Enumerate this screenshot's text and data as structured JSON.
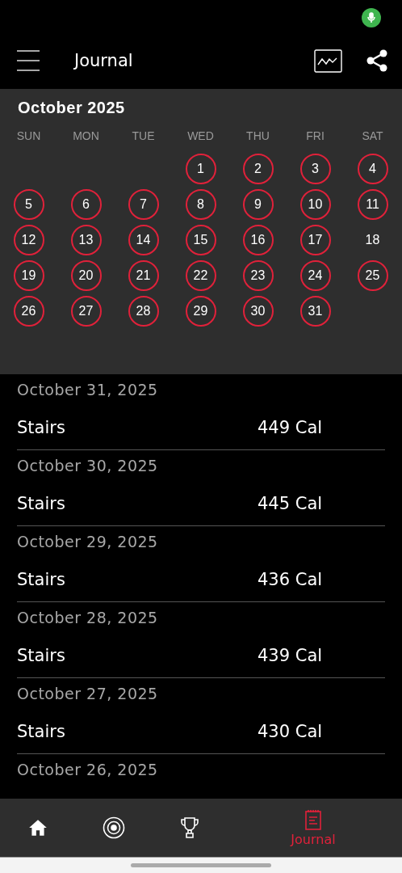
{
  "header": {
    "title": "Journal"
  },
  "calendar": {
    "month": "October 2025",
    "weekdays": [
      "SUN",
      "MON",
      "TUE",
      "WED",
      "THU",
      "FRI",
      "SAT"
    ],
    "weeks": [
      [
        {
          "day": "1",
          "logged": true
        },
        {
          "day": "2",
          "logged": true
        },
        {
          "day": "3",
          "logged": true
        },
        {
          "day": "4",
          "logged": true
        }
      ],
      [
        {
          "day": "5",
          "logged": true
        },
        {
          "day": "6",
          "logged": true
        },
        {
          "day": "7",
          "logged": true
        },
        {
          "day": "8",
          "logged": true
        },
        {
          "day": "9",
          "logged": true
        },
        {
          "day": "10",
          "logged": true
        },
        {
          "day": "11",
          "logged": true
        }
      ],
      [
        {
          "day": "12",
          "logged": true
        },
        {
          "day": "13",
          "logged": true
        },
        {
          "day": "14",
          "logged": true
        },
        {
          "day": "15",
          "logged": true
        },
        {
          "day": "16",
          "logged": true
        },
        {
          "day": "17",
          "logged": true
        },
        {
          "day": "18",
          "logged": false
        }
      ],
      [
        {
          "day": "19",
          "logged": true
        },
        {
          "day": "20",
          "logged": true
        },
        {
          "day": "21",
          "logged": true
        },
        {
          "day": "22",
          "logged": true
        },
        {
          "day": "23",
          "logged": true
        },
        {
          "day": "24",
          "logged": true
        },
        {
          "day": "25",
          "logged": true
        }
      ],
      [
        {
          "day": "26",
          "logged": true
        },
        {
          "day": "27",
          "logged": true
        },
        {
          "day": "28",
          "logged": true
        },
        {
          "day": "29",
          "logged": true
        },
        {
          "day": "30",
          "logged": true
        },
        {
          "day": "31",
          "logged": true
        }
      ]
    ]
  },
  "journal": [
    {
      "date": "October 31, 2025",
      "entries": [
        {
          "activity": "Stairs",
          "calories": "449 Cal"
        }
      ]
    },
    {
      "date": "October 30, 2025",
      "entries": [
        {
          "activity": "Stairs",
          "calories": "445 Cal"
        }
      ]
    },
    {
      "date": "October 29, 2025",
      "entries": [
        {
          "activity": "Stairs",
          "calories": "436 Cal"
        }
      ]
    },
    {
      "date": "October 28, 2025",
      "entries": [
        {
          "activity": "Stairs",
          "calories": "439 Cal"
        }
      ]
    },
    {
      "date": "October 27, 2025",
      "entries": [
        {
          "activity": "Stairs",
          "calories": "430 Cal"
        }
      ]
    },
    {
      "date": "October 26, 2025"
    }
  ],
  "nav": [
    {
      "kind": "home",
      "selected": false
    },
    {
      "kind": "target",
      "selected": false
    },
    {
      "kind": "trophy",
      "selected": false
    },
    {
      "kind": "journal",
      "selected": true,
      "label": "Journal"
    }
  ]
}
